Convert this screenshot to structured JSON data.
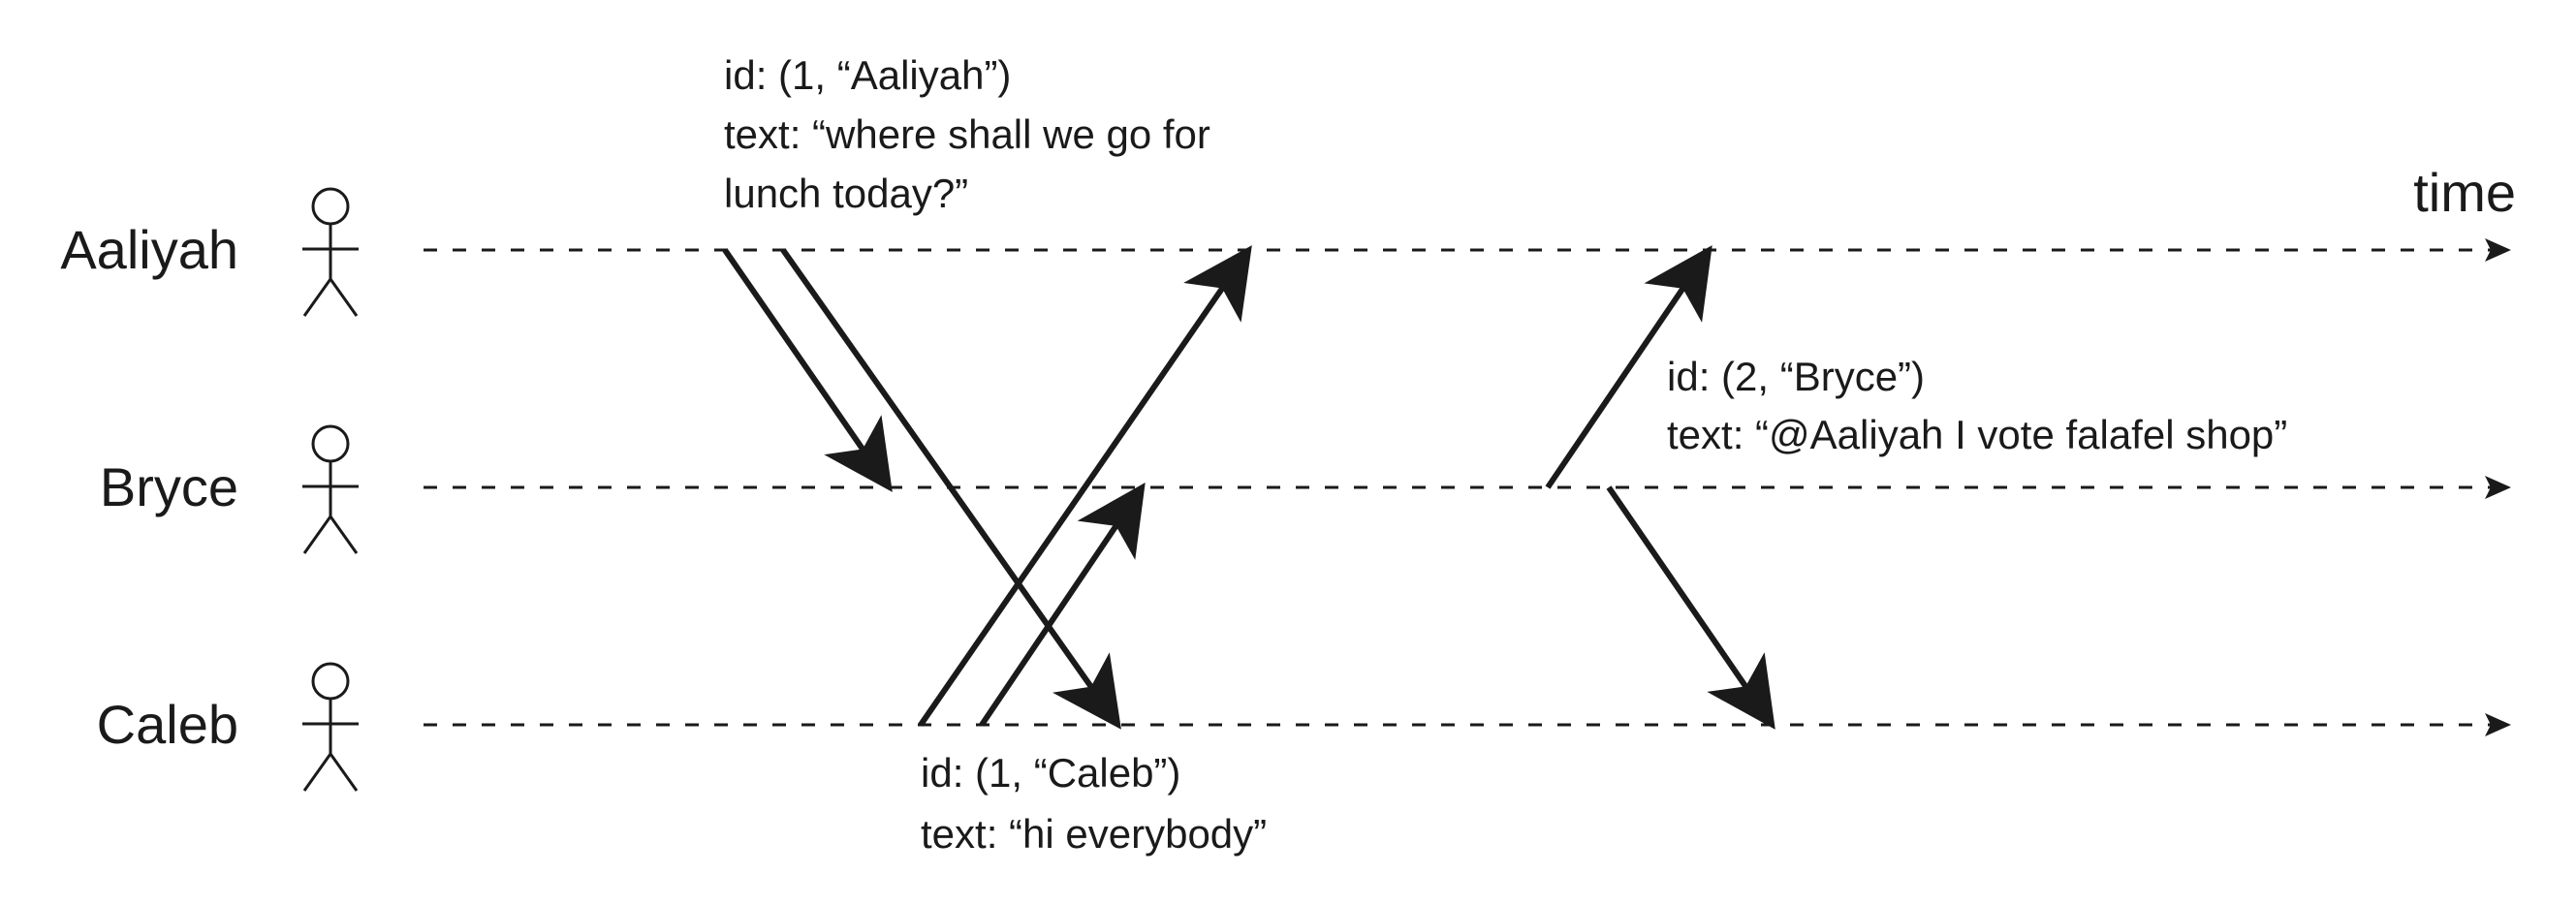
{
  "time_label": "time",
  "actors": [
    {
      "id": "aaliyah",
      "name": "Aaliyah"
    },
    {
      "id": "bryce",
      "name": "Bryce"
    },
    {
      "id": "caleb",
      "name": "Caleb"
    }
  ],
  "notes": {
    "aaliyah_msg": {
      "line1": "id: (1, “Aaliyah”)",
      "line2": "text: “where shall we go for",
      "line3": "lunch today?”"
    },
    "bryce_msg": {
      "line1": "id: (2, “Bryce”)",
      "line2": "text: “@Aaliyah I vote falafel shop”"
    },
    "caleb_msg": {
      "line1": "id: (1, “Caleb”)",
      "line2": "text: “hi everybody”"
    }
  },
  "colors": {
    "ink": "#1a1a1a",
    "background": "#ffffff"
  }
}
